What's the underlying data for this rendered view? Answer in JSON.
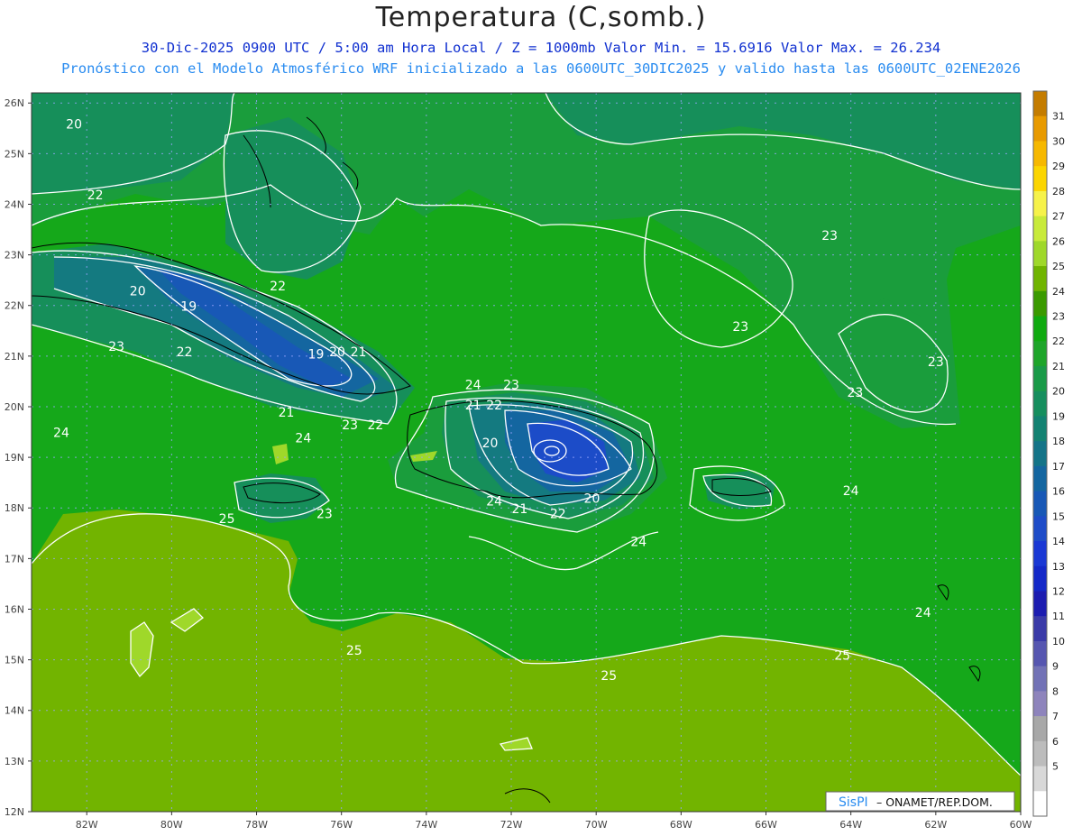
{
  "header": {
    "title": "Temperatura (C,somb.)",
    "subtitle1": "30-Dic-2025  0900 UTC / 5:00 am Hora Local / Z = 1000mb    Valor Min. = 15.6916  Valor Max. = 26.234",
    "subtitle2": "Pronóstico con el Modelo Atmosférico WRF inicializado a las 0600UTC_30DIC2025 y valido hasta las  0600UTC_02ENE2026"
  },
  "axes": {
    "lat_labels": [
      "26N",
      "25N",
      "24N",
      "23N",
      "22N",
      "21N",
      "20N",
      "19N",
      "18N",
      "17N",
      "16N",
      "15N",
      "14N",
      "13N",
      "12N"
    ],
    "lon_labels": [
      "82W",
      "80W",
      "78W",
      "76W",
      "74W",
      "72W",
      "70W",
      "68W",
      "66W",
      "64W",
      "62W",
      "60W"
    ]
  },
  "colorbar": {
    "labels": [
      "31",
      "30",
      "29",
      "28",
      "27",
      "26",
      "25",
      "24",
      "23",
      "22",
      "21",
      "20",
      "19",
      "18",
      "17",
      "16",
      "15",
      "14",
      "13",
      "12",
      "11",
      "10",
      "9",
      "8",
      "7",
      "6",
      "5"
    ],
    "colors": [
      "#c47c00",
      "#e89a00",
      "#f6b800",
      "#fbd500",
      "#f6f24a",
      "#c8ea3a",
      "#9fd82a",
      "#70b400",
      "#3a9a00",
      "#10aa10",
      "#1ea52a",
      "#1a9a48",
      "#168e5e",
      "#138272",
      "#147488",
      "#1466a0",
      "#1858b6",
      "#1e4cc8",
      "#1a38d4",
      "#1428c8",
      "#1c1cb0",
      "#3a3aa8",
      "#5656b0",
      "#7272b6",
      "#8e84bc",
      "#a8a8a8",
      "#bcbcbc",
      "#d8d8d8",
      "#ffffff"
    ]
  },
  "contour_labels": [
    {
      "t": "20",
      "lon": -82.3,
      "lat": 25.5
    },
    {
      "t": "22",
      "lon": -81.8,
      "lat": 24.1
    },
    {
      "t": "22",
      "lon": -77.5,
      "lat": 22.3
    },
    {
      "t": "20",
      "lon": -80.8,
      "lat": 22.2
    },
    {
      "t": "19",
      "lon": -79.6,
      "lat": 21.9
    },
    {
      "t": "23",
      "lon": -81.3,
      "lat": 21.1
    },
    {
      "t": "22",
      "lon": -79.7,
      "lat": 21.0
    },
    {
      "t": "19",
      "lon": -76.6,
      "lat": 20.95
    },
    {
      "t": "20",
      "lon": -76.1,
      "lat": 21.0
    },
    {
      "t": "21",
      "lon": -75.6,
      "lat": 21.0
    },
    {
      "t": "21",
      "lon": -77.3,
      "lat": 19.8
    },
    {
      "t": "23",
      "lon": -75.8,
      "lat": 19.55
    },
    {
      "t": "22",
      "lon": -75.2,
      "lat": 19.55
    },
    {
      "t": "24",
      "lon": -82.6,
      "lat": 19.4
    },
    {
      "t": "24",
      "lon": -76.9,
      "lat": 19.3
    },
    {
      "t": "25",
      "lon": -78.7,
      "lat": 17.7
    },
    {
      "t": "23",
      "lon": -76.4,
      "lat": 17.8
    },
    {
      "t": "24",
      "lon": -72.9,
      "lat": 20.35
    },
    {
      "t": "23",
      "lon": -72.0,
      "lat": 20.35
    },
    {
      "t": "21",
      "lon": -72.9,
      "lat": 19.95
    },
    {
      "t": "22",
      "lon": -72.4,
      "lat": 19.95
    },
    {
      "t": "20",
      "lon": -72.5,
      "lat": 19.2
    },
    {
      "t": "24",
      "lon": -72.4,
      "lat": 18.05
    },
    {
      "t": "21",
      "lon": -71.8,
      "lat": 17.9
    },
    {
      "t": "20",
      "lon": -70.1,
      "lat": 18.1
    },
    {
      "t": "22",
      "lon": -70.9,
      "lat": 17.8
    },
    {
      "t": "24",
      "lon": -69.0,
      "lat": 17.25
    },
    {
      "t": "25",
      "lon": -75.7,
      "lat": 15.1
    },
    {
      "t": "25",
      "lon": -69.7,
      "lat": 14.6
    },
    {
      "t": "25",
      "lon": -64.2,
      "lat": 15.0
    },
    {
      "t": "23",
      "lon": -64.5,
      "lat": 23.3
    },
    {
      "t": "23",
      "lon": -66.6,
      "lat": 21.5
    },
    {
      "t": "23",
      "lon": -63.9,
      "lat": 20.2
    },
    {
      "t": "23",
      "lon": -62.0,
      "lat": 20.8
    },
    {
      "t": "24",
      "lon": -64.0,
      "lat": 18.25
    },
    {
      "t": "24",
      "lon": -62.3,
      "lat": 15.85
    }
  ],
  "footer": {
    "brand": "SisPI",
    "credit": " – ONAMET/REP.DOM."
  }
}
